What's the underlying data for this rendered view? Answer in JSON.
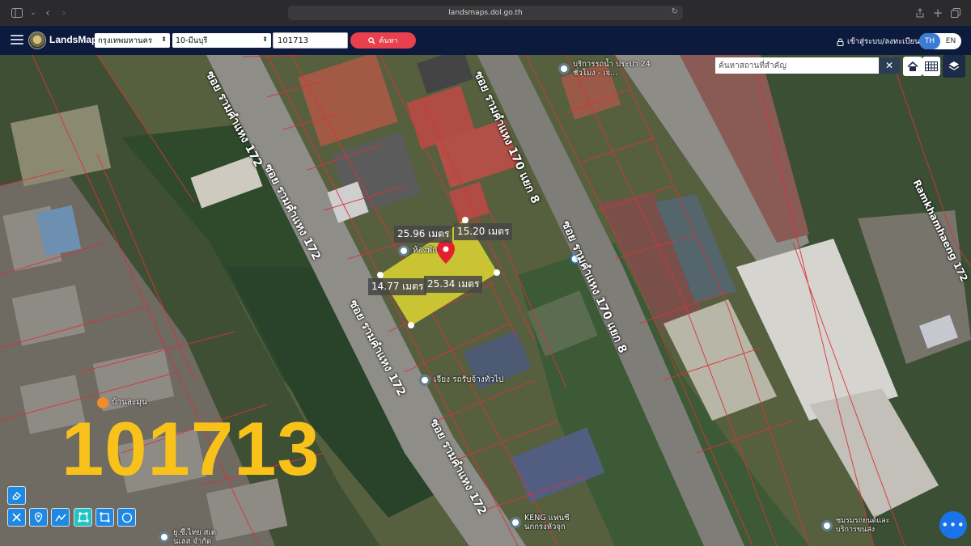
{
  "browser": {
    "url": "landsmaps.dol.go.th"
  },
  "header": {
    "brand": "LandsMaps",
    "province": "กรุงเทพมหานคร",
    "district": "10-มีนบุรี",
    "parcel_value": "101713",
    "search_label": "ค้นหา",
    "login_label": "เข้าสู่ระบบ/ลงทะเบียน",
    "lang_th": "TH",
    "lang_en": "EN"
  },
  "map": {
    "search_placeholder": "ค้นหาสถานที่สำคัญ",
    "parcel_overlay_number": "101713",
    "road_labels": [
      "ซอย รามคำแหง 172",
      "ซอย รามคำแหง 172",
      "ซอย รามคำแหง 172",
      "ซอย รามคำแหง 170 แยก 8",
      "ซอย รามคำแหง 170 แยก 8",
      "Ramkhamhaeng 172",
      "ซอย รามคำแหง 172"
    ],
    "dimensions": {
      "top_left": "25.96 เมตร",
      "top_right": "15.20 เมตร",
      "bottom_left": "14.77 เมตร",
      "bottom_right": "25.34 เมตร"
    },
    "pois": [
      {
        "name": "บริการรถน้ำ ประปา 24 ชั่วโมง - เจ..."
      },
      {
        "name": "ห้องพัก"
      },
      {
        "name": "เจียง รถรับจ้างทั่วไป"
      },
      {
        "name": "บ้านละมุน"
      },
      {
        "name": "KENG แฟนซี นกกรงหัวจุก"
      },
      {
        "name": "ยู.ซี.ไทย สเตนเลส จำกัด"
      },
      {
        "name": "ชมรมรถยนต์และ บริการขนส่ง"
      }
    ]
  },
  "colors": {
    "header_bg": "#0c1a3d",
    "search_button": "#e8404c",
    "parcel_fill": "#e8e030",
    "parcel_number": "#f8c21a",
    "boundary": "#d9323a",
    "draw_tool": "#1e88e5"
  },
  "icons": {
    "sidebar": "sidebar-icon",
    "back": "chevron-left-icon",
    "forward": "chevron-right-icon",
    "reload": "reload-icon",
    "share": "share-icon",
    "new_tab": "plus-icon",
    "tabs": "tabs-icon",
    "lock": "lock-icon",
    "home": "home-icon",
    "grid": "grid-icon",
    "layers": "layers-icon",
    "marker": "map-marker-icon",
    "more": "more-icon"
  }
}
